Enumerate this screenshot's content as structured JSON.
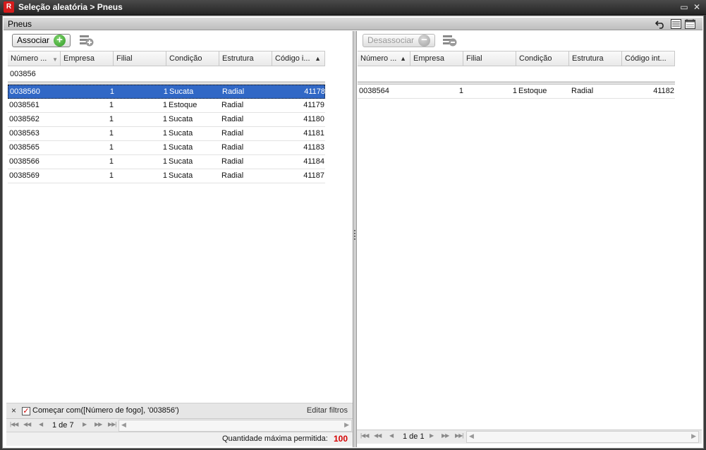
{
  "window": {
    "title": "Seleção aleatória > Pneus",
    "app_icon_glyph": "R",
    "restore_glyph": "▭",
    "close_glyph": "✕"
  },
  "panel": {
    "title": "Pneus"
  },
  "left": {
    "associate_label": "Associar",
    "columns": [
      "Número ...",
      "Empresa",
      "Filial",
      "Condição",
      "Estrutura",
      "Código i..."
    ],
    "filter_value": "003856",
    "rows": [
      {
        "numero": "0038560",
        "empresa": "1",
        "filial": "1",
        "condicao": "Sucata",
        "estrutura": "Radial",
        "codigo": "41178",
        "selected": true
      },
      {
        "numero": "0038561",
        "empresa": "1",
        "filial": "1",
        "condicao": "Estoque",
        "estrutura": "Radial",
        "codigo": "41179"
      },
      {
        "numero": "0038562",
        "empresa": "1",
        "filial": "1",
        "condicao": "Sucata",
        "estrutura": "Radial",
        "codigo": "41180"
      },
      {
        "numero": "0038563",
        "empresa": "1",
        "filial": "1",
        "condicao": "Sucata",
        "estrutura": "Radial",
        "codigo": "41181"
      },
      {
        "numero": "0038565",
        "empresa": "1",
        "filial": "1",
        "condicao": "Sucata",
        "estrutura": "Radial",
        "codigo": "41183"
      },
      {
        "numero": "0038566",
        "empresa": "1",
        "filial": "1",
        "condicao": "Sucata",
        "estrutura": "Radial",
        "codigo": "41184"
      },
      {
        "numero": "0038569",
        "empresa": "1",
        "filial": "1",
        "condicao": "Sucata",
        "estrutura": "Radial",
        "codigo": "41187"
      }
    ],
    "filter_text": "Começar com([Número de fogo], '003856')",
    "edit_filters": "Editar filtros",
    "pager_text": "1 de 7",
    "max_label": "Quantidade máxima permitida:",
    "max_value": "100"
  },
  "right": {
    "disassociate_label": "Desassociar",
    "columns": [
      "Número ...",
      "Empresa",
      "Filial",
      "Condição",
      "Estrutura",
      "Código int..."
    ],
    "rows": [
      {
        "numero": "0038564",
        "empresa": "1",
        "filial": "1",
        "condicao": "Estoque",
        "estrutura": "Radial",
        "codigo": "41182"
      }
    ],
    "pager_text": "1 de 1"
  },
  "colors": {
    "selection": "#3168c6",
    "max_value": "#d40000",
    "add_green": "#2f9a25"
  }
}
